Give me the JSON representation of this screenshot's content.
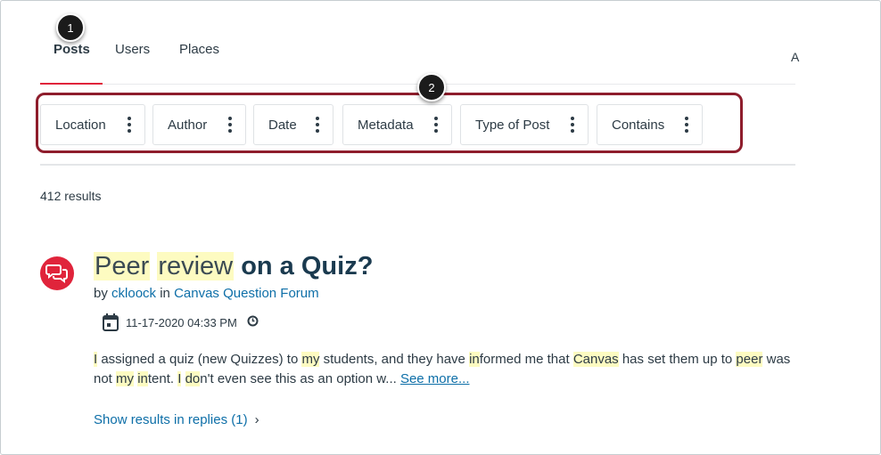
{
  "callouts": [
    "1",
    "2"
  ],
  "tabs": [
    {
      "label": "Posts",
      "active": true
    },
    {
      "label": "Users",
      "active": false
    },
    {
      "label": "Places",
      "active": false
    }
  ],
  "tab_cutoff_text": "A",
  "filters": [
    {
      "label": "Location"
    },
    {
      "label": "Author"
    },
    {
      "label": "Date"
    },
    {
      "label": "Metadata"
    },
    {
      "label": "Type of Post"
    },
    {
      "label": "Contains"
    }
  ],
  "results_count": "412 results",
  "result": {
    "icon": "chat-bubbles-icon",
    "title_parts": [
      "Peer",
      " ",
      "review",
      " on a Quiz?"
    ],
    "byline": {
      "prefix": "by ",
      "author": "ckloock",
      "in": " in ",
      "board": "Canvas Question Forum"
    },
    "date": "11-17-2020 04:33 PM",
    "snippet_parts": [
      {
        "t": "I",
        "hl": true
      },
      {
        "t": " assigned a quiz (new Quizzes) to ",
        "hl": false
      },
      {
        "t": "my",
        "hl": true
      },
      {
        "t": " students, and they have ",
        "hl": false
      },
      {
        "t": "in",
        "hl": true
      },
      {
        "t": "formed me that ",
        "hl": false
      },
      {
        "t": "Canvas",
        "hl": true
      },
      {
        "t": " has set them up to ",
        "hl": false
      },
      {
        "t": "peer",
        "hl": true
      },
      {
        "t": " was not ",
        "hl": false
      },
      {
        "t": "my",
        "hl": true
      },
      {
        "t": " ",
        "hl": false
      },
      {
        "t": "in",
        "hl": true
      },
      {
        "t": "tent.  ",
        "hl": false
      },
      {
        "t": "I",
        "hl": true
      },
      {
        "t": " ",
        "hl": false
      },
      {
        "t": "do",
        "hl": true
      },
      {
        "t": "n't even see this as an option w... ",
        "hl": false
      }
    ],
    "see_more": "See more...",
    "show_replies": "Show results in replies (1)",
    "chevron": "›"
  },
  "colors": {
    "accent_red": "#e0243b",
    "link_blue": "#0e6fa8",
    "highlight": "#fdfbc1",
    "callout_box": "#8e1d2c"
  }
}
